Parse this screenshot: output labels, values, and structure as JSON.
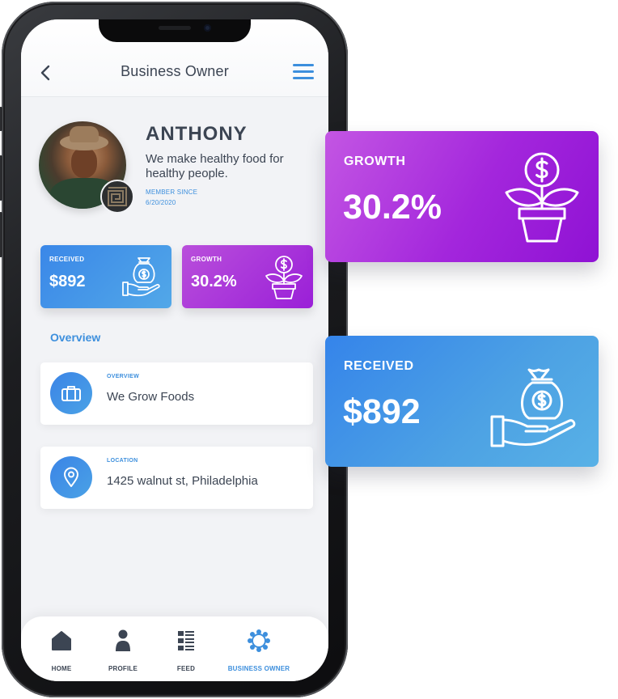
{
  "header": {
    "title": "Business Owner"
  },
  "profile": {
    "name": "ANTHONY",
    "bio": "We make healthy food for healthy people.",
    "member_since_label": "MEMBER SINCE",
    "member_since_date": "6/20/2020"
  },
  "stats": {
    "received_label": "RECEIVED",
    "received_value": "$892",
    "growth_label": "GROWTH",
    "growth_value": "30.2%"
  },
  "section": {
    "overview_title": "Overview"
  },
  "info_cards": [
    {
      "caption": "OVERVIEW",
      "text": "We Grow Foods",
      "icon": "briefcase-icon"
    },
    {
      "caption": "LOCATION",
      "text": "1425 walnut st, Philadelphia",
      "icon": "map-pin-icon"
    }
  ],
  "bottom_nav": [
    {
      "label": "HOME",
      "icon": "home-icon"
    },
    {
      "label": "PROFILE",
      "icon": "user-icon"
    },
    {
      "label": "FEED",
      "icon": "feed-list-icon"
    },
    {
      "label": "BUSINESS OWNER",
      "icon": "network-icon",
      "active": true
    }
  ],
  "colors": {
    "accent_blue": "#3d8fdd",
    "growth_purple": "#a326dc",
    "text_dark": "#3c4553"
  }
}
